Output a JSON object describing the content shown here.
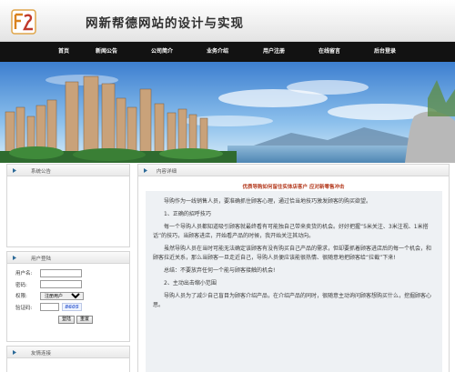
{
  "site": {
    "title": "网新帮德网站的设计与实现"
  },
  "nav": {
    "items": [
      "首页",
      "新闻公告",
      "公司简介",
      "业务介绍",
      "用户注册",
      "在线留言",
      "后台登录"
    ]
  },
  "sidebar": {
    "announcement_title": "系统公告",
    "login_title": "用户登陆",
    "login": {
      "username_label": "用户名:",
      "password_label": "密码:",
      "role_label": "权限:",
      "role_value": "注册用户",
      "captcha_label": "验证码:",
      "captcha_code": "8605",
      "login_button": "登陆",
      "reset_button": "重置"
    },
    "links_title": "友情连接"
  },
  "main": {
    "section_title": "内容详细",
    "article_title": "优质导购如何留住实体店客户 应对新零售冲击",
    "paragraphs": [
      "导购作为一线销售人员，要准确抓住顾客心理，通过恰当地技巧激发顾客的购买欲望。",
      "1、正确的招呼技巧",
      "每一个导购人员都知道吸引顾客就最终看有可能独自己带来卖货的机会。好好把握“5米关注、3米注视、1米搭话”的技巧，当顾客进店，开始看产品的时候，我开始关注其动向。",
      "虽然导购人员在当时可能无法确定该顾客有没有购买自己产品的需求，但却要抓着顾客进店后的每一个机会，和顾客拉近关系，那么当顾客一旦走近自己，导购人员便应该能很热情、很随意地把顾客给“拉截”下来!",
      "总结：不要放弃任何一个能与顾客接触的机会!",
      "2、主动出击缩小范围",
      "导购人员为了减少自己盲目为顾客介绍产品，在介绍产品的同时，很随意主动询问顾客想购买什么，挖掘顾客心思。"
    ]
  },
  "colors": {
    "nav_bg": "#121212",
    "article_title": "#b43a1e",
    "content_bg": "#eef1f4"
  }
}
